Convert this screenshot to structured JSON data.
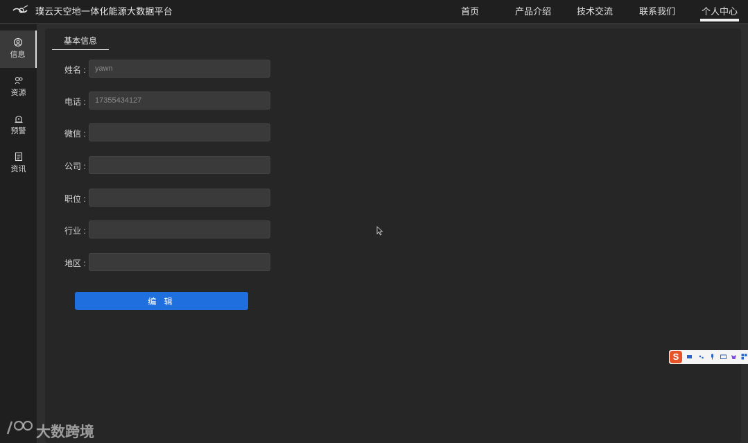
{
  "header": {
    "title": "璞云天空地一体化能源大数据平台",
    "nav": [
      {
        "label": "首页"
      },
      {
        "label": "产品介绍"
      },
      {
        "label": "技术交流"
      },
      {
        "label": "联系我们"
      },
      {
        "label": "个人中心",
        "active": true
      }
    ]
  },
  "sidebar": {
    "items": [
      {
        "label": "信息",
        "icon": "user-circle-icon",
        "active": true
      },
      {
        "label": "资源",
        "icon": "resource-icon"
      },
      {
        "label": "预警",
        "icon": "alert-icon"
      },
      {
        "label": "资讯",
        "icon": "news-icon"
      }
    ]
  },
  "main": {
    "tab": "基本信息",
    "form": {
      "name": {
        "label": "姓名 :",
        "value": "yawn"
      },
      "phone": {
        "label": "电话 :",
        "value": "17355434127"
      },
      "wechat": {
        "label": "微信 :",
        "value": ""
      },
      "company": {
        "label": "公司 :",
        "value": ""
      },
      "position": {
        "label": "职位 :",
        "value": ""
      },
      "industry": {
        "label": "行业 :",
        "value": ""
      },
      "region": {
        "label": "地区 :",
        "value": ""
      }
    },
    "edit_label": "编 辑"
  },
  "ime": {
    "logo": "S"
  },
  "watermark": {
    "text": "大数跨境"
  },
  "colors": {
    "accent": "#1f6fde",
    "background": "#2e2e2e",
    "panel": "#262626",
    "topbar": "#1f1f1f"
  }
}
